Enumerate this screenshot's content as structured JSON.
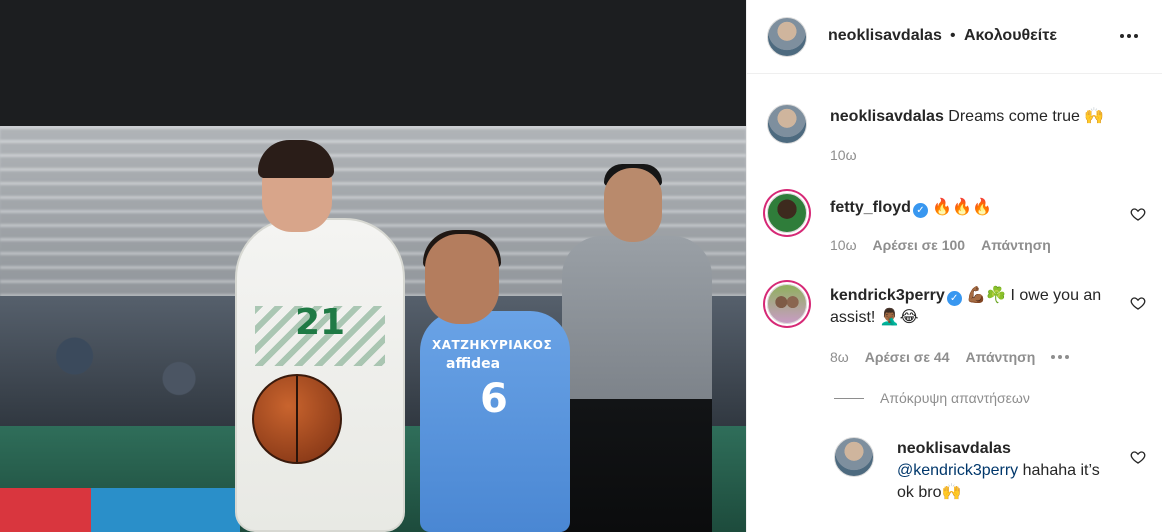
{
  "post": {
    "author": "neoklisavdalas",
    "separator": "•",
    "follow_status": "Ακολουθείτε",
    "caption": {
      "username": "neoklisavdalas",
      "text": "Dreams come true 🙌",
      "time": "10ω"
    },
    "photo": {
      "player_number_green": "21",
      "player_number_blue": "6",
      "player_name_blue": "ΧΑΤΖΗΚΥΡΙΑΚΟΣ",
      "sponsor_blue": "affidea"
    }
  },
  "comments": [
    {
      "username": "fetty_floyd",
      "verified": true,
      "text": "🔥🔥🔥",
      "time": "10ω",
      "likes": "Αρέσει σε 100",
      "reply": "Απάντηση"
    },
    {
      "username": "kendrick3perry",
      "verified": true,
      "text": "💪🏾☘️ I owe you an assist! 🤦🏾‍♂️😂",
      "time": "8ω",
      "likes": "Αρέσει σε 44",
      "reply": "Απάντηση"
    }
  ],
  "hide_replies": "Απόκρυψη απαντήσεων",
  "reply": {
    "username": "neoklisavdalas",
    "mention": "@kendrick3perry",
    "text": " hahaha it’s ok bro🙌"
  },
  "icons": {
    "more": "more-options-icon",
    "heart": "heart-outline-icon",
    "verified": "verified-badge-icon"
  },
  "colors": {
    "text": "#262626",
    "muted": "#8e8e8e",
    "verified": "#3897f0",
    "mention": "#00376b",
    "story_ring": "#d62976"
  }
}
